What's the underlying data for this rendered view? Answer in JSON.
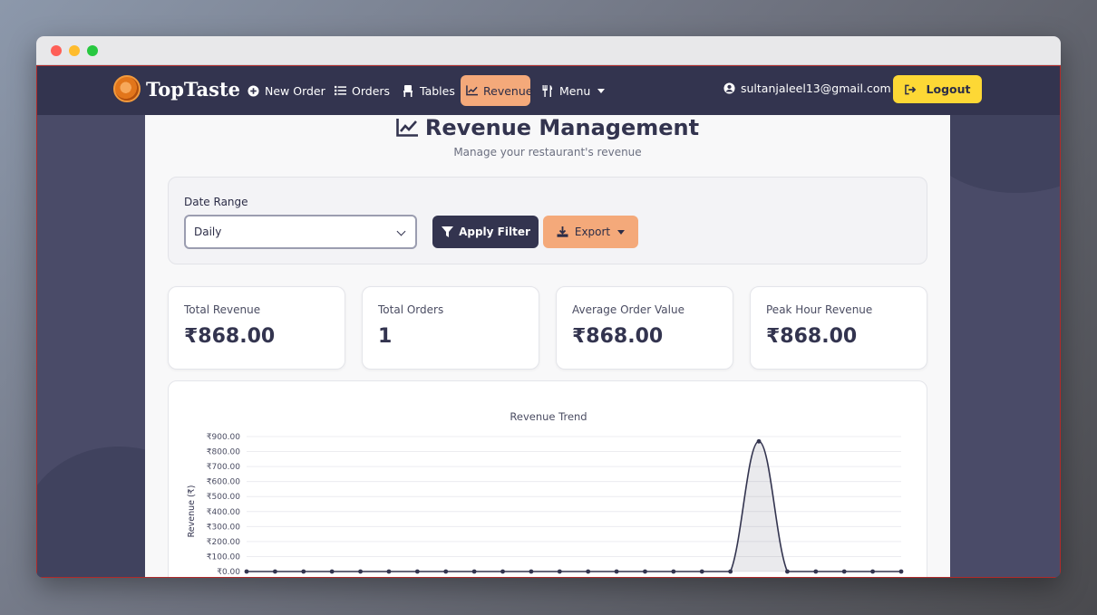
{
  "nav": {
    "brand": "TopTaste",
    "items": [
      {
        "label": "New Order",
        "icon": "plus-circle-icon"
      },
      {
        "label": "Orders",
        "icon": "list-icon"
      },
      {
        "label": "Tables",
        "icon": "chair-icon"
      },
      {
        "label": "Revenue",
        "icon": "chart-line-icon",
        "active": true
      },
      {
        "label": "Menu",
        "icon": "utensils-icon"
      }
    ],
    "user_email": "sultanjaleel13@gmail.com",
    "logout_label": "Logout"
  },
  "page": {
    "title": "Revenue Management",
    "subtitle": "Manage your restaurant's revenue"
  },
  "filter": {
    "date_range_label": "Date Range",
    "date_range_value": "Daily",
    "apply_label": "Apply Filter",
    "export_label": "Export"
  },
  "stats": [
    {
      "label": "Total Revenue",
      "value": "₹868.00"
    },
    {
      "label": "Total Orders",
      "value": "1"
    },
    {
      "label": "Average Order Value",
      "value": "₹868.00"
    },
    {
      "label": "Peak Hour Revenue",
      "value": "₹868.00"
    }
  ],
  "colors": {
    "navbar": "#33344f",
    "accent_orange": "#f4a97a",
    "logout_yellow": "#fdd835",
    "line": "#33344f"
  },
  "chart_data": {
    "type": "line",
    "title": "Revenue Trend",
    "ylabel": "Revenue (₹)",
    "ylim": [
      0,
      900
    ],
    "yticks": [
      "₹0.00",
      "₹100.00",
      "₹200.00",
      "₹300.00",
      "₹400.00",
      "₹500.00",
      "₹600.00",
      "₹700.00",
      "₹800.00",
      "₹900.00"
    ],
    "values": [
      0,
      0,
      0,
      0,
      0,
      0,
      0,
      0,
      0,
      0,
      0,
      0,
      0,
      0,
      0,
      0,
      0,
      0,
      868,
      0,
      0,
      0,
      0,
      0
    ],
    "fill": true
  }
}
